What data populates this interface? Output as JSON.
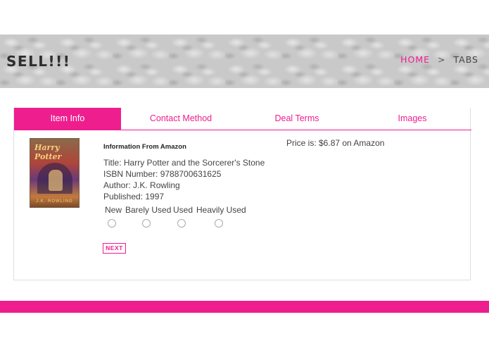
{
  "header": {
    "brand": "SELL!!!",
    "breadcrumb": {
      "home": "HOME",
      "separator": ">",
      "current": "TABS"
    }
  },
  "tabs": [
    {
      "label": "Item Info",
      "active": true
    },
    {
      "label": "Contact Method",
      "active": false
    },
    {
      "label": "Deal Terms",
      "active": false
    },
    {
      "label": "Images",
      "active": false
    }
  ],
  "book": {
    "cover": {
      "title": "Harry Potter",
      "author": "J.K. ROWLING"
    },
    "heading": "Information From Amazon",
    "title_line": "Title: Harry Potter and the Sorcerer's Stone",
    "isbn_line": "ISBN Number: 9788700631625",
    "author_line": "Author: J.K. Rowling",
    "published_line": "Published: 1997",
    "price_line": "Price is: $6.87 on Amazon"
  },
  "conditions": {
    "options": [
      "New",
      "Barely Used",
      "Used",
      "Heavily Used"
    ],
    "selected": null
  },
  "actions": {
    "next_label": "NEXT"
  },
  "colors": {
    "accent": "#ee1e8f",
    "text": "#444444",
    "brand": "#2e2e2e"
  }
}
